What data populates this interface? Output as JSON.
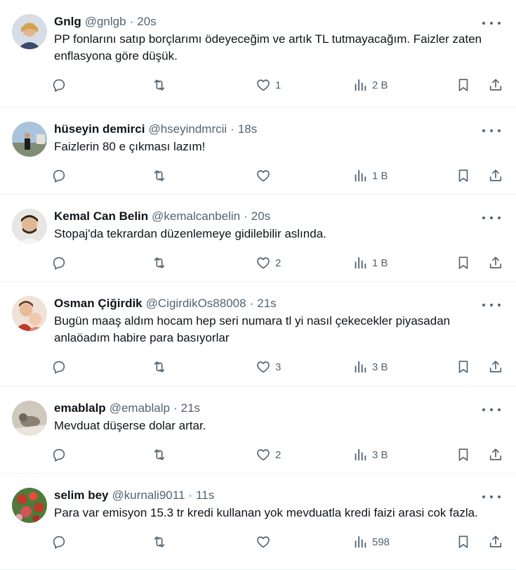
{
  "tweets": [
    {
      "name": "Gnlg",
      "handle": "@gnlgb",
      "time": "20s",
      "text": "PP fonlarını satıp borçlarımı ödeyeceğim ve artık TL tutmayacağım. Faizler zaten enflasyona göre düşük.",
      "replies": "",
      "retweets": "",
      "likes": "1",
      "views": "2 B",
      "avatar_color": "#c8b9a0"
    },
    {
      "name": "hüseyin demirci",
      "handle": "@hseyindmrcii",
      "time": "18s",
      "text": "Faizlerin 80 e çıkması lazım!",
      "replies": "",
      "retweets": "",
      "likes": "",
      "views": "1 B",
      "avatar_color": "#8fb0c9"
    },
    {
      "name": "Kemal Can Belin",
      "handle": "@kemalcanbelin",
      "time": "20s",
      "text": "Stopaj'da tekrardan düzenlemeye gidilebilir aslında.",
      "replies": "",
      "retweets": "",
      "likes": "2",
      "views": "1 B",
      "avatar_color": "#d9d4cf"
    },
    {
      "name": "Osman Çiğirdik",
      "handle": "@CigirdikOs88008",
      "time": "21s",
      "text": "Bugün maaş aldım hocam hep seri numara tl yi nasıl çekecekler piyasadan anlaöadım habire para basıyorlar",
      "replies": "",
      "retweets": "",
      "likes": "3",
      "views": "3 B",
      "avatar_color": "#d8a58f"
    },
    {
      "name": "emablalp",
      "handle": "@emablalp",
      "time": "21s",
      "text": "Mevduat düşerse dolar artar.",
      "replies": "",
      "retweets": "",
      "likes": "2",
      "views": "3 B",
      "avatar_color": "#b9b2a6"
    },
    {
      "name": "selim bey",
      "handle": "@kurnali9011",
      "time": "11s",
      "text": "Para var emisyon 15.3 tr kredi kullanan yok mevduatla kredi faizi arasi cok fazla.",
      "replies": "",
      "retweets": "",
      "likes": "",
      "views": "598",
      "avatar_color": "#c0392b"
    }
  ],
  "icons": {
    "reply": "reply-icon",
    "retweet": "retweet-icon",
    "like": "heart-icon",
    "views": "views-icon",
    "bookmark": "bookmark-icon",
    "share": "share-icon",
    "more": "more-icon"
  },
  "colors": {
    "text": "#0f1419",
    "secondary": "#536471",
    "divider": "#eff3f4"
  }
}
